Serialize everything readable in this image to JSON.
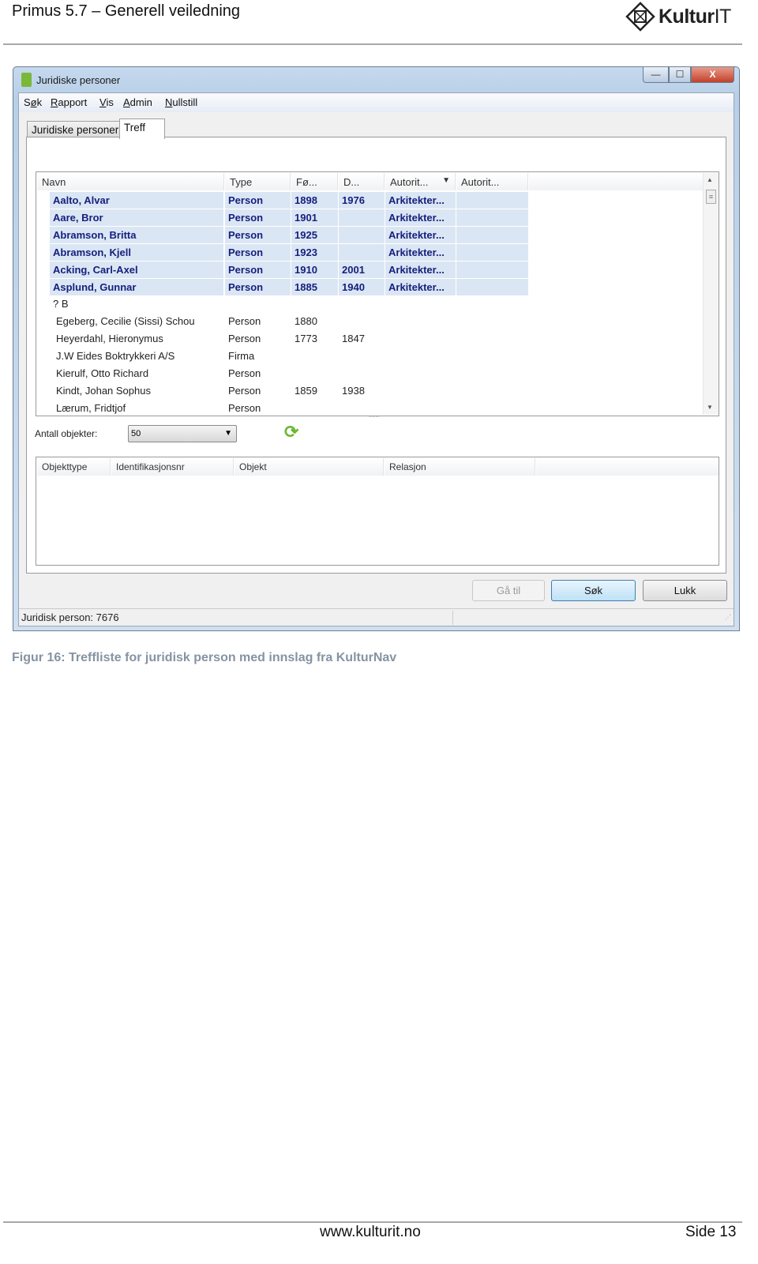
{
  "document": {
    "header_title": "Primus 5.7 – Generell veiledning",
    "logo_text": {
      "bold": "Kultur",
      "light": "IT"
    },
    "caption": "Figur 16: Treffliste for juridisk person med innslag fra KulturNav",
    "footer_url": "www.kulturit.no",
    "footer_page": "Side 13"
  },
  "window": {
    "title": "Juridiske personer",
    "controls": {
      "minimize": "—",
      "maximize": "☐",
      "close": "X"
    },
    "menu": [
      "Søk",
      "Rapport",
      "Vis",
      "Admin",
      "Nullstill"
    ],
    "menu_accelerators": [
      "ø",
      "R",
      "V",
      "A",
      "N"
    ],
    "tabs": [
      {
        "label": "Juridiske personer",
        "active": false
      },
      {
        "label": "Treff",
        "active": true
      }
    ],
    "results_grid": {
      "columns": [
        "Navn",
        "Type",
        "Fø...",
        "D...",
        "Autorit...",
        "Autorit..."
      ],
      "sort_indicator": "▼",
      "selected_row_color": "#dbe6f4",
      "rows": [
        {
          "navn": "Aalto, Alvar",
          "type": "Person",
          "fodt": "1898",
          "dod": "1976",
          "autoritet": "Arkitekter...",
          "selected": true
        },
        {
          "navn": "Aare, Bror",
          "type": "Person",
          "fodt": "1901",
          "dod": "",
          "autoritet": "Arkitekter...",
          "selected": true
        },
        {
          "navn": "Abramson, Britta",
          "type": "Person",
          "fodt": "1925",
          "dod": "",
          "autoritet": "Arkitekter...",
          "selected": true
        },
        {
          "navn": "Abramson, Kjell",
          "type": "Person",
          "fodt": "1923",
          "dod": "",
          "autoritet": "Arkitekter...",
          "selected": true
        },
        {
          "navn": "Acking, Carl-Axel",
          "type": "Person",
          "fodt": "1910",
          "dod": "2001",
          "autoritet": "Arkitekter...",
          "selected": true
        },
        {
          "navn": "Asplund, Gunnar",
          "type": "Person",
          "fodt": "1885",
          "dod": "1940",
          "autoritet": "Arkitekter...",
          "selected": true
        },
        {
          "navn": "? B",
          "type": "",
          "fodt": "",
          "dod": "",
          "autoritet": "",
          "selected": false
        },
        {
          "navn": "Egeberg, Cecilie (Sissi) Schou",
          "type": "Person",
          "fodt": "1880",
          "dod": "",
          "autoritet": "",
          "selected": false
        },
        {
          "navn": "Heyerdahl, Hieronymus",
          "type": "Person",
          "fodt": "1773",
          "dod": "1847",
          "autoritet": "",
          "selected": false
        },
        {
          "navn": "J.W Eides Boktrykkeri  A/S",
          "type": "Firma",
          "fodt": "",
          "dod": "",
          "autoritet": "",
          "selected": false
        },
        {
          "navn": "Kierulf, Otto Richard",
          "type": "Person",
          "fodt": "",
          "dod": "",
          "autoritet": "",
          "selected": false
        },
        {
          "navn": "Kindt, Johan Sophus",
          "type": "Person",
          "fodt": "1859",
          "dod": "1938",
          "autoritet": "",
          "selected": false
        },
        {
          "navn": "Lærum, Fridtjof",
          "type": "Person",
          "fodt": "",
          "dod": "",
          "autoritet": "",
          "selected": false
        }
      ]
    },
    "count": {
      "label": "Antall objekter:",
      "value": "50"
    },
    "relations_grid": {
      "columns": [
        "Objekttype",
        "Identifikasjonsnr",
        "Objekt",
        "Relasjon"
      ]
    },
    "buttons": {
      "goto": "Gå til",
      "search": "Søk",
      "close": "Lukk"
    },
    "status": "Juridisk person: 7676"
  }
}
